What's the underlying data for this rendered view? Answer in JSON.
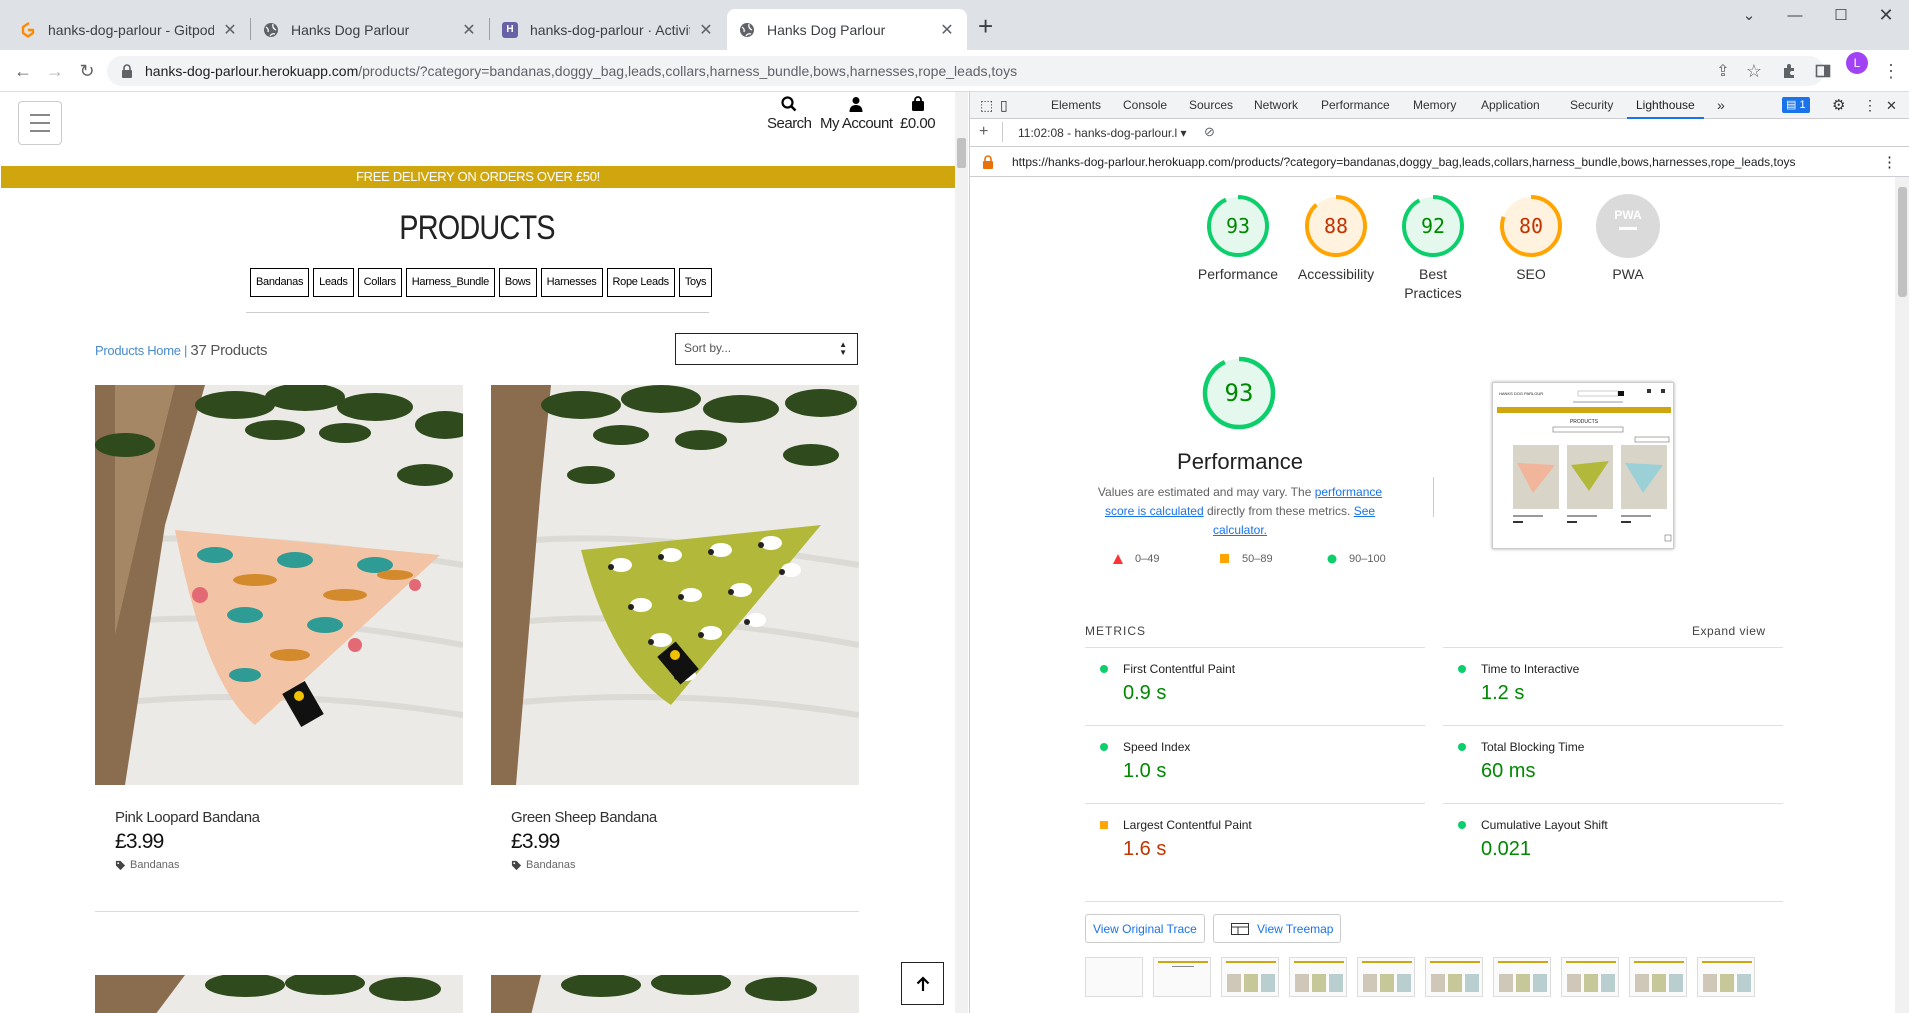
{
  "browser": {
    "tabs": [
      {
        "title": "hanks-dog-parlour - Gitpod Code",
        "favicon_color": "#ff8a00"
      },
      {
        "title": "Hanks Dog Parlour",
        "favicon_color": "#5f6368"
      },
      {
        "title": "hanks-dog-parlour · Activity | Heroku",
        "favicon_color": "#6762a6"
      },
      {
        "title": "Hanks Dog Parlour",
        "favicon_color": "#5f6368"
      }
    ],
    "url_host": "hanks-dog-parlour.herokuapp.com",
    "url_path": "/products/?category=bandanas,doggy_bag,leads,collars,harness_bundle,bows,harnesses,rope_leads,toys",
    "avatar_letter": "L"
  },
  "site": {
    "nav": {
      "search": "Search",
      "account": "My Account",
      "bag": "£0.00"
    },
    "banner": "FREE DELIVERY ON ORDERS OVER £50!",
    "title": "PRODUCTS",
    "categories": [
      "Bandanas",
      "Leads",
      "Collars",
      "Harness_Bundle",
      "Bows",
      "Harnesses",
      "Rope Leads",
      "Toys"
    ],
    "crumb_link": "Products Home",
    "crumb_sep": " | ",
    "count": "37 Products",
    "sort": "Sort by...",
    "products": [
      {
        "name": "Pink Loopard Bandana",
        "price": "£3.99",
        "tag": "Bandanas"
      },
      {
        "name": "Green Sheep Bandana",
        "price": "£3.99",
        "tag": "Bandanas"
      }
    ],
    "accent": "#cfa60e"
  },
  "devtools": {
    "tabs": [
      "Elements",
      "Console",
      "Sources",
      "Network",
      "Performance",
      "Memory",
      "Application",
      "Security",
      "Lighthouse"
    ],
    "issues_count": "1",
    "report_time": "11:02:08 - hanks-dog-parlour.l",
    "report_url": "https://hanks-dog-parlour.herokuapp.com/products/?category=bandanas,doggy_bag,leads,collars,harness_bundle,bows,harnesses,rope_leads,toys",
    "scores": [
      {
        "label": "Performance",
        "value": 93,
        "color": "#0cce6b",
        "text": "#008800"
      },
      {
        "label": "Accessibility",
        "value": 88,
        "color": "#ffa400",
        "text": "#c33300"
      },
      {
        "label": "Best Practices",
        "value": 92,
        "color": "#0cce6b",
        "text": "#008800"
      },
      {
        "label": "SEO",
        "value": 80,
        "color": "#ffa400",
        "text": "#c33300"
      },
      {
        "label": "PWA",
        "value": null,
        "color": "#999999",
        "text": "#999999"
      }
    ],
    "perf": {
      "score": 93,
      "title": "Performance",
      "desc1": "Values are estimated and may vary. The ",
      "link1": "performance score is calculated",
      "desc2": " directly from these metrics. ",
      "link2": "See calculator."
    },
    "legend": [
      "0–49",
      "50–89",
      "90–100"
    ],
    "metrics_heading": "METRICS",
    "expand": "Expand view",
    "metrics": [
      {
        "name": "First Contentful Paint",
        "value": "0.9 s",
        "status": "pass"
      },
      {
        "name": "Time to Interactive",
        "value": "1.2 s",
        "status": "pass"
      },
      {
        "name": "Speed Index",
        "value": "1.0 s",
        "status": "pass"
      },
      {
        "name": "Total Blocking Time",
        "value": "60 ms",
        "status": "pass"
      },
      {
        "name": "Largest Contentful Paint",
        "value": "1.6 s",
        "status": "average"
      },
      {
        "name": "Cumulative Layout Shift",
        "value": "0.021",
        "status": "pass"
      }
    ],
    "btn_trace": "View Original Trace",
    "btn_treemap": "View Treemap",
    "thumb_text": {
      "brand": "HANKS DOG PARLOUR",
      "title": "PRODUCTS"
    }
  }
}
